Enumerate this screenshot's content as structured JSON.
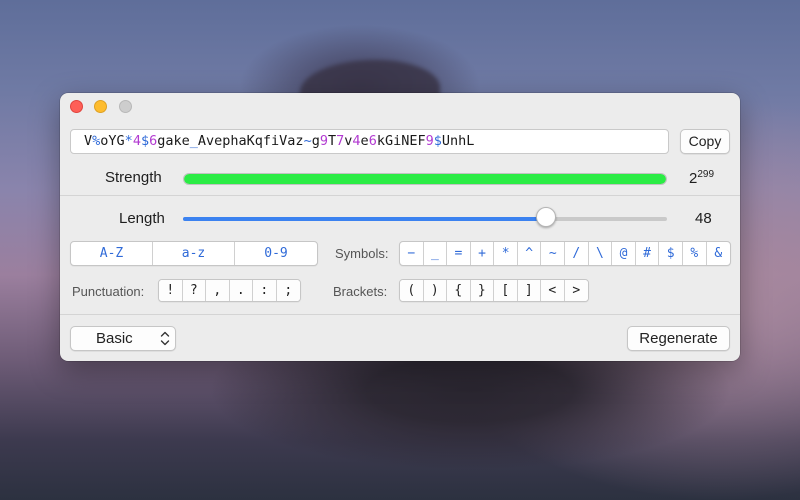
{
  "password": {
    "segments": [
      {
        "t": "V",
        "k": "txt"
      },
      {
        "t": "%",
        "k": "sym"
      },
      {
        "t": "oYG",
        "k": "txt"
      },
      {
        "t": "*",
        "k": "sym"
      },
      {
        "t": "4",
        "k": "num"
      },
      {
        "t": "$",
        "k": "sym"
      },
      {
        "t": "6",
        "k": "num"
      },
      {
        "t": "gake",
        "k": "txt"
      },
      {
        "t": "_",
        "k": "sym"
      },
      {
        "t": "AvephaKqfiVaz",
        "k": "txt"
      },
      {
        "t": "~",
        "k": "sym"
      },
      {
        "t": "g",
        "k": "txt"
      },
      {
        "t": "9",
        "k": "num"
      },
      {
        "t": "T",
        "k": "txt"
      },
      {
        "t": "7",
        "k": "num"
      },
      {
        "t": "v",
        "k": "txt"
      },
      {
        "t": "4",
        "k": "num"
      },
      {
        "t": "e",
        "k": "txt"
      },
      {
        "t": "6",
        "k": "num"
      },
      {
        "t": "kGiNEF",
        "k": "txt"
      },
      {
        "t": "9",
        "k": "num"
      },
      {
        "t": "$",
        "k": "sym"
      },
      {
        "t": "UnhL",
        "k": "txt"
      }
    ],
    "copy_label": "Copy"
  },
  "strength": {
    "label": "Strength",
    "value_base": "2",
    "value_exp": "299",
    "fill_fraction": 1.0,
    "fill_color": "#2bec45"
  },
  "length": {
    "label": "Length",
    "value": "48",
    "min": 0,
    "max": 64,
    "current": 48,
    "accent_color": "#3b82f0"
  },
  "charsets": [
    "A-Z",
    "a-z",
    "0-9"
  ],
  "symbols": {
    "label": "Symbols:",
    "items": [
      "−",
      "_",
      "=",
      "+",
      "*",
      "^",
      "~",
      "/",
      "\\",
      "@",
      "#",
      "$",
      "%",
      "&"
    ]
  },
  "punctuation": {
    "label": "Punctuation:",
    "items": [
      "!",
      "?",
      ",",
      ".",
      ":",
      ";"
    ]
  },
  "brackets": {
    "label": "Brackets:",
    "items": [
      "(",
      ")",
      "{",
      "}",
      "[",
      "]",
      "<",
      ">"
    ]
  },
  "preset": {
    "selected": "Basic"
  },
  "regenerate_label": "Regenerate"
}
